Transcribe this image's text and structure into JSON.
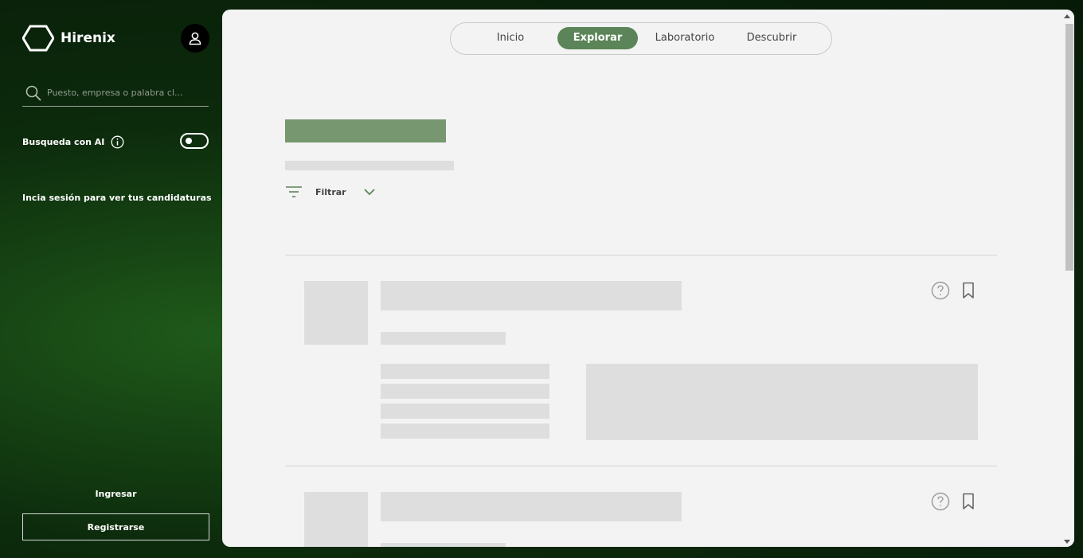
{
  "sidebar": {
    "brand": "Hirenix",
    "search_placeholder": "Puesto, empresa o palabra cl...",
    "ai_search_label": "Busqueda con AI",
    "login_hint": "Incia sesión para ver tus candidaturas",
    "login_label": "Ingresar",
    "register_label": "Registrarse"
  },
  "nav": {
    "tabs": [
      {
        "label": "Inicio",
        "active": false
      },
      {
        "label": "Explorar",
        "active": true
      },
      {
        "label": "Laboratorio",
        "active": false
      },
      {
        "label": "Descubrir",
        "active": false
      }
    ]
  },
  "toolbar": {
    "filter_label": "Filtrar"
  },
  "theme": {
    "accent": "#5b8458",
    "panel_bg": "#f3f3f3",
    "skeleton": "#dedede"
  },
  "icons": [
    "hexagon-logo-icon",
    "user-icon",
    "search-icon",
    "info-icon",
    "filter-icon",
    "chevron-down-icon",
    "question-icon",
    "bookmark-icon"
  ]
}
